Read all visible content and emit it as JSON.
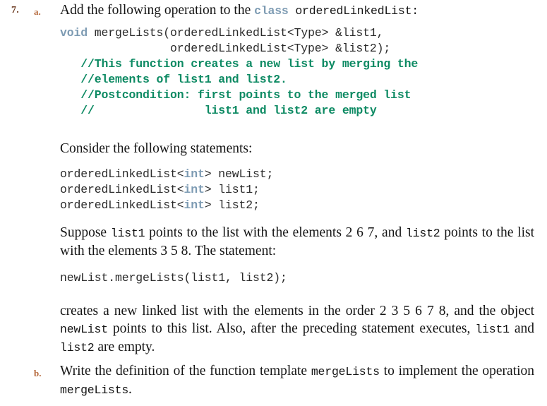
{
  "exercise": {
    "number": "7.",
    "sub_a": "a.",
    "sub_b": "b."
  },
  "intro": {
    "before_keyword": "Add the following operation to the ",
    "keyword": "class",
    "after_keyword": " orderedLinkedList:"
  },
  "code_declaration": {
    "keyword_void": "void",
    "signature_line1": " mergeLists(orderedLinkedList<Type> &list1,",
    "signature_line2": "                orderedLinkedList<Type> &list2);",
    "comment_line1": "   //This function creates a new list by merging the",
    "comment_line2": "   //elements of list1 and list2.",
    "comment_line3": "   //Postcondition: first points to the merged list",
    "comment_line4": "   //                list1 and list2 are empty"
  },
  "consider": {
    "text": "Consider the following statements:"
  },
  "code_variables": {
    "line1_pre": "orderedLinkedList<",
    "line1_kw": "int",
    "line1_post": "> newList;",
    "line2_pre": "orderedLinkedList<",
    "line2_kw": "int",
    "line2_post": "> list1;",
    "line3_pre": "orderedLinkedList<",
    "line3_kw": "int",
    "line3_post": "> list2;"
  },
  "paragraph_suppose": {
    "seg1": "Suppose ",
    "code1": "list1",
    "seg2": " points to the list with the elements 2 6 7, and ",
    "code2": "list2",
    "seg3": " points to the list with the elements 3 5 8. The statement:"
  },
  "code_call": {
    "text": "newList.mergeLists(list1, list2);"
  },
  "paragraph_creates": {
    "seg1": "creates a new linked list with the elements in the order 2 3 5 6 7 8, and the object ",
    "code1": "newList",
    "seg2": " points to this list. Also, after the preceding statement executes, ",
    "code2": "list1",
    "seg3": " and ",
    "code3": "list2",
    "seg4": " are empty."
  },
  "paragraph_write": {
    "seg1": "Write the definition of the function template ",
    "code1": "mergeLists",
    "seg2": " to implement the operation ",
    "code2": "mergeLists",
    "seg3": "."
  },
  "colors": {
    "keyword": "#7d9bb3",
    "comment": "#0d8a63",
    "number_marker": "#6b3a20",
    "letter_marker": "#b5693c",
    "body_text": "#141414",
    "background": "#ffffff"
  }
}
